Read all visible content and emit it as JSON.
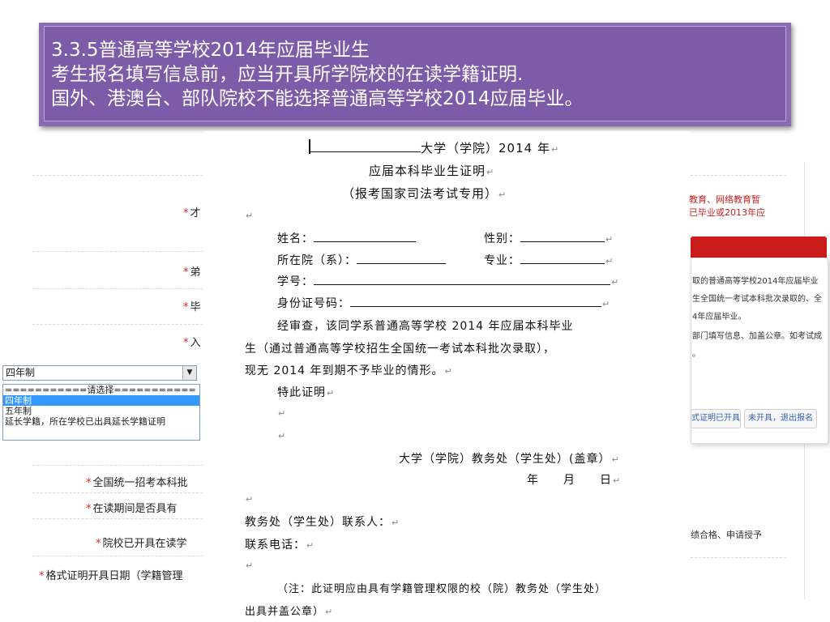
{
  "banner": {
    "line1": "3.3.5普通高等学校2014年应届毕业生",
    "line2": "考生报名填写信息前，应当开具所学院校的在读学籍证明.",
    "line3": "国外、港澳台、部队院校不能选择普通高等学校2014应届毕业。"
  },
  "form": {
    "label1": "*",
    "label1_tail": "才",
    "label2": "*",
    "label2_tail": "弟",
    "label3": "*",
    "label3_tail": "毕",
    "label4": "*",
    "label4_tail": "入",
    "select_value": "四年制",
    "options": [
      "===========请选择===========",
      "四年制",
      "五年制",
      "延长学籍，所在学校已出具延长学籍证明"
    ],
    "q1": "全国统一招考本科批",
    "q2": "在读期间是否具有",
    "q3": "院校已开具在读学",
    "q4": "格式证明开具日期（学籍管理"
  },
  "right": {
    "line1": "教育、网络教育暂",
    "line2": "已毕业或2013年应",
    "d1": "取的普通高等学校2014年应届毕业",
    "d2": "生全国统一考试本科批次录取的、全",
    "d3": "4年应届毕业。",
    "d4": "部门填写信息、加盖公章。如考试成",
    "d5": "。",
    "btn1": "式证明已开具",
    "btn2": "未开具，退出报名",
    "note": "绩合格、申请授予"
  },
  "certificate": {
    "title1_suffix": "大学（学院）2014 年",
    "title2": "应届本科毕业生证明",
    "title3": "（报考国家司法考试专用）",
    "name_label": "姓名：",
    "gender_label": "性别：",
    "dept_label": "所在院（系）：",
    "major_label": "专业：",
    "student_id_label": "学号：",
    "id_card_label": "身份证号码：",
    "body1": "经审查，该同学系普通高等学校 2014 年应届本科毕业",
    "body2": "生（通过普通高等学校招生全国统一考试本科批次录取），",
    "body3": "现无 2014 年到期不予毕业的情形。",
    "certify": "特此证明",
    "issuer": "大学（学院）教务处（学生处）(盖章）",
    "date": "年　　月　　日",
    "contact_label": "教务处（学生处）联系人：",
    "phone_label": "联系电话：",
    "note1": "（注：此证明应由具有学籍管理权限的校（院）教务处（学生处）",
    "note2": "出具并盖公章）",
    "paragraph_mark": "↵"
  }
}
